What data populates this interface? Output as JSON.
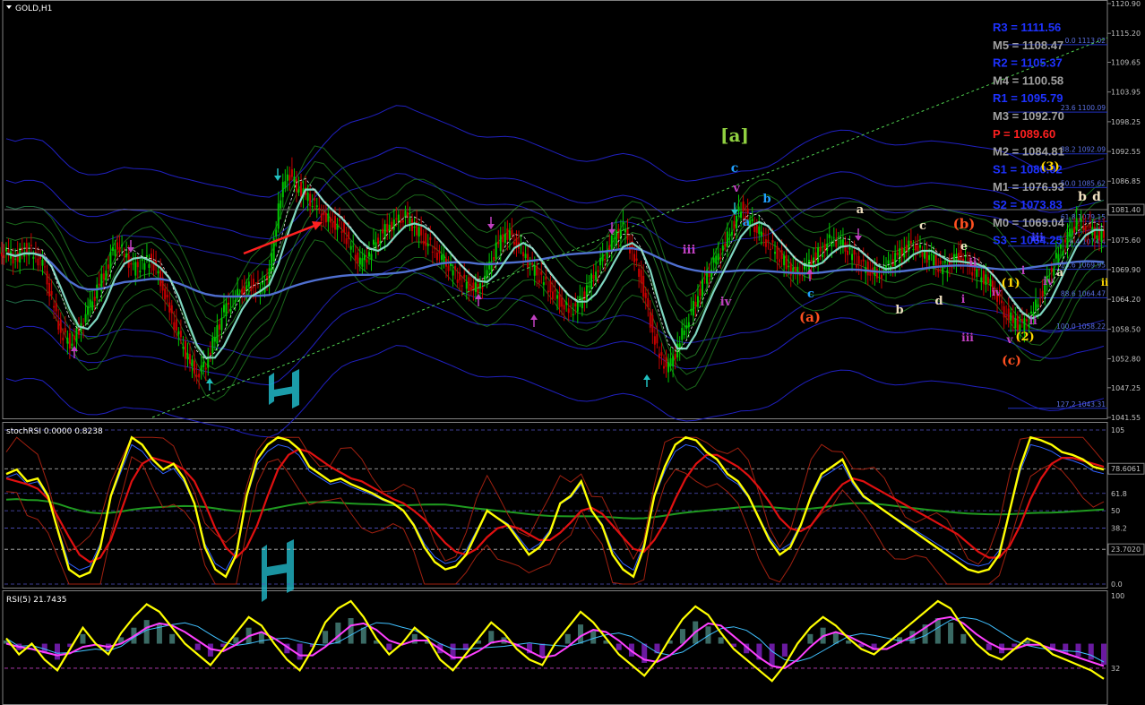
{
  "window": {
    "symbol_title": "GOLD,H1"
  },
  "colors": {
    "background": "#000000",
    "bull_candle": "#00c800",
    "bear_candle": "#c80000",
    "blue_band": "#1e1eb4",
    "green_band": "#1f7a1f",
    "ma_teal": "#7fd6c0",
    "ma_blue": "#4f6fd0",
    "stoch_yellow": "#ffff00",
    "stoch_red": "#e01010",
    "rsi_magenta": "#ff40ff",
    "pivot_blue": "#1e32ff",
    "pivot_gray": "#a0a0a0",
    "pivot_red": "#ff2020"
  },
  "price_axis": {
    "ticks": [
      "1120.90",
      "1115.20",
      "1109.65",
      "1103.95",
      "1098.25",
      "1092.55",
      "1086.85",
      "1081.40",
      "1075.60",
      "1069.90",
      "1064.20",
      "1058.50",
      "1052.80",
      "1047.25",
      "1041.55"
    ],
    "current_price": "1081.40"
  },
  "pivots": [
    {
      "label": "R3 = 1111.56",
      "color": "#1e32ff"
    },
    {
      "label": "M5 = 1108.47",
      "color": "#a0a0a0"
    },
    {
      "label": "R2 = 1105.37",
      "color": "#1e32ff"
    },
    {
      "label": "M4 = 1100.58",
      "color": "#a0a0a0"
    },
    {
      "label": "R1 = 1095.79",
      "color": "#1e32ff"
    },
    {
      "label": "M3 = 1092.70",
      "color": "#a0a0a0"
    },
    {
      "label": "P  = 1089.60",
      "color": "#ff2020"
    },
    {
      "label": "M2 = 1084.81",
      "color": "#a0a0a0"
    },
    {
      "label": "S1 = 1080.02",
      "color": "#1e32ff"
    },
    {
      "label": "M1 = 1076.93",
      "color": "#a0a0a0"
    },
    {
      "label": "S2 = 1073.83",
      "color": "#1e32ff"
    },
    {
      "label": "M0 = 1069.04",
      "color": "#a0a0a0"
    },
    {
      "label": "S3 = 1064.25",
      "color": "#1e32ff"
    }
  ],
  "fib_levels": [
    "0.0  1113.02",
    "23.6  1100.09",
    "38.2  1092.09",
    "50.0  1085.62",
    "61.8  1079.15",
    "76.4  1074.4",
    "23.6  1069.95",
    "88.6  1064.47",
    "100.0  1058.22",
    "127.2  1043.31"
  ],
  "wave_labels": [
    "[a]",
    "c",
    "v",
    "a",
    "b",
    "iii",
    "iv",
    "c",
    "(a)",
    "a",
    "b",
    "c",
    "(b)",
    "e",
    "d",
    "ii",
    "i",
    "iv",
    "iii",
    "(1)",
    "(2)",
    "v",
    "(c)",
    "ii",
    "iii",
    "iv",
    "i",
    "(3)",
    "a",
    "b",
    "d",
    "ii"
  ],
  "stoch_panel": {
    "title": "stochRSI 0.0000 0.8238",
    "ticks": [
      "105",
      "78.6061",
      "61.8",
      "50",
      "38.2",
      "23.7020",
      "0.0"
    ]
  },
  "rsi_panel": {
    "title": "RSI(5) 21.7435",
    "ticks": [
      "100",
      "32"
    ]
  },
  "chart_data": [
    {
      "type": "line",
      "title": "GOLD,H1",
      "ylim": [
        1041.55,
        1120.9
      ],
      "series": [
        {
          "values": [
            1073,
            1072,
            1074,
            1073,
            1071,
            1064,
            1058,
            1056,
            1058,
            1062,
            1066,
            1070,
            1075,
            1073,
            1070,
            1071,
            1072,
            1068,
            1062,
            1057,
            1053,
            1050,
            1052,
            1057,
            1062,
            1064,
            1066,
            1067,
            1066,
            1069,
            1082,
            1089,
            1086,
            1084,
            1082,
            1080,
            1079,
            1078,
            1074,
            1071,
            1073,
            1076,
            1078,
            1079,
            1080,
            1078,
            1076,
            1074,
            1072,
            1070,
            1068,
            1067,
            1066,
            1069,
            1074,
            1077,
            1076,
            1073,
            1070,
            1068,
            1066,
            1064,
            1062,
            1063,
            1066,
            1070,
            1073,
            1076,
            1078,
            1073,
            1068,
            1060,
            1053,
            1051,
            1055,
            1060,
            1064,
            1068,
            1071,
            1074,
            1078,
            1082,
            1079,
            1077,
            1075,
            1073,
            1071,
            1069,
            1070,
            1072,
            1074,
            1076,
            1075,
            1073,
            1071,
            1070,
            1069,
            1070,
            1072,
            1074,
            1075,
            1073,
            1072,
            1070,
            1071,
            1073,
            1071,
            1069,
            1068,
            1066,
            1062,
            1060,
            1059,
            1061,
            1065,
            1069,
            1073,
            1076,
            1079,
            1078,
            1077,
            1076
          ]
        }
      ]
    },
    {
      "type": "line",
      "title": "stochRSI 0.0000 0.8238",
      "ylim": [
        0,
        105
      ],
      "series": [
        {
          "values": [
            75,
            78,
            70,
            72,
            60,
            35,
            10,
            5,
            8,
            25,
            60,
            80,
            100,
            95,
            85,
            78,
            82,
            72,
            55,
            25,
            10,
            5,
            20,
            60,
            85,
            95,
            100,
            98,
            92,
            80,
            75,
            70,
            72,
            68,
            65,
            62,
            58,
            55,
            50,
            40,
            25,
            15,
            10,
            12,
            20,
            35,
            50,
            45,
            40,
            30,
            20,
            25,
            35,
            55,
            60,
            70,
            50,
            40,
            20,
            10,
            5,
            25,
            60,
            80,
            95,
            100,
            98,
            90,
            85,
            75,
            70,
            60,
            45,
            30,
            20,
            25,
            40,
            60,
            75,
            80,
            85,
            70,
            60,
            55,
            50,
            45,
            40,
            35,
            30,
            25,
            20,
            15,
            10,
            8,
            10,
            20,
            50,
            80,
            100,
            98,
            95,
            90,
            88,
            85,
            80,
            78
          ]
        },
        {
          "values": [
            72,
            70,
            68,
            65,
            58,
            45,
            32,
            20,
            15,
            18,
            30,
            50,
            70,
            82,
            86,
            84,
            82,
            78,
            70,
            55,
            38,
            25,
            18,
            25,
            40,
            60,
            78,
            88,
            92,
            90,
            85,
            80,
            76,
            72,
            70,
            66,
            62,
            58,
            55,
            50,
            44,
            36,
            28,
            22,
            20,
            24,
            32,
            38,
            40,
            38,
            34,
            30,
            30,
            35,
            42,
            50,
            52,
            48,
            40,
            32,
            24,
            22,
            30,
            42,
            58,
            72,
            82,
            88,
            88,
            84,
            80,
            74,
            66,
            56,
            45,
            38,
            36,
            40,
            50,
            60,
            68,
            72,
            70,
            66,
            62,
            58,
            54,
            50,
            46,
            42,
            38,
            34,
            28,
            22,
            18,
            18,
            26,
            40,
            58,
            72,
            82,
            86,
            86,
            84,
            82,
            80
          ]
        }
      ]
    },
    {
      "type": "line",
      "title": "RSI(5) 21.7435",
      "ylim": [
        0,
        100
      ],
      "series": [
        {
          "values": [
            60,
            45,
            55,
            40,
            30,
            50,
            70,
            55,
            45,
            65,
            80,
            92,
            85,
            70,
            55,
            45,
            35,
            50,
            65,
            80,
            72,
            55,
            40,
            30,
            50,
            75,
            88,
            95,
            80,
            60,
            45,
            55,
            70,
            60,
            40,
            30,
            45,
            60,
            75,
            65,
            50,
            40,
            35,
            55,
            70,
            85,
            75,
            60,
            45,
            35,
            25,
            40,
            60,
            78,
            90,
            82,
            65,
            50,
            40,
            30,
            20,
            35,
            55,
            70,
            80,
            72,
            60,
            50,
            45,
            55,
            65,
            75,
            85,
            95,
            88,
            70,
            55,
            45,
            40,
            50,
            60,
            55,
            45,
            40,
            35,
            30,
            22
          ]
        },
        {
          "values": [
            55,
            52,
            50,
            47,
            44,
            46,
            52,
            54,
            52,
            55,
            62,
            70,
            74,
            72,
            66,
            58,
            50,
            48,
            54,
            62,
            66,
            60,
            52,
            44,
            44,
            52,
            62,
            72,
            74,
            68,
            58,
            54,
            58,
            58,
            50,
            42,
            42,
            48,
            56,
            58,
            54,
            48,
            42,
            44,
            52,
            62,
            68,
            66,
            58,
            48,
            40,
            38,
            44,
            54,
            66,
            74,
            72,
            62,
            52,
            42,
            34,
            32,
            40,
            52,
            62,
            66,
            62,
            56,
            50,
            50,
            56,
            62,
            70,
            78,
            80,
            74,
            64,
            56,
            50,
            50,
            54,
            54,
            50,
            46,
            42,
            38,
            34
          ]
        }
      ]
    }
  ]
}
